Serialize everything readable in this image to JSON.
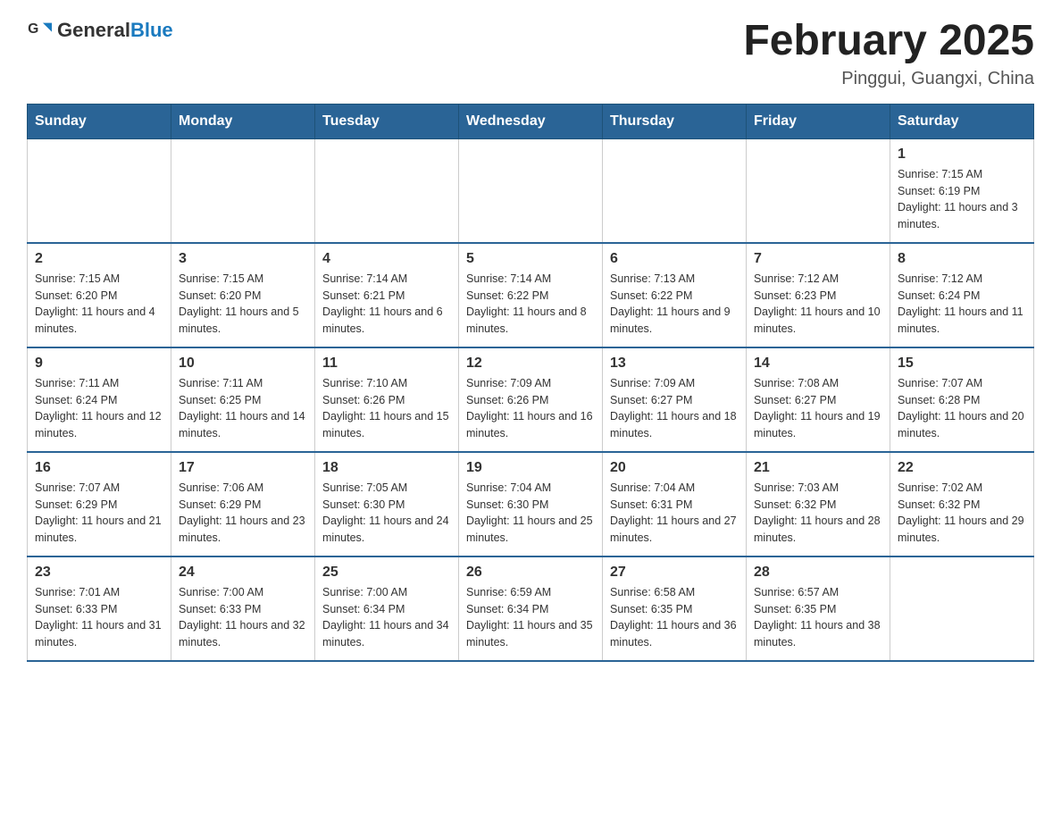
{
  "header": {
    "logo_general": "General",
    "logo_blue": "Blue",
    "month_title": "February 2025",
    "location": "Pinggui, Guangxi, China"
  },
  "days_of_week": [
    "Sunday",
    "Monday",
    "Tuesday",
    "Wednesday",
    "Thursday",
    "Friday",
    "Saturday"
  ],
  "weeks": [
    {
      "days": [
        {
          "num": "",
          "info": ""
        },
        {
          "num": "",
          "info": ""
        },
        {
          "num": "",
          "info": ""
        },
        {
          "num": "",
          "info": ""
        },
        {
          "num": "",
          "info": ""
        },
        {
          "num": "",
          "info": ""
        },
        {
          "num": "1",
          "info": "Sunrise: 7:15 AM\nSunset: 6:19 PM\nDaylight: 11 hours and 3 minutes."
        }
      ]
    },
    {
      "days": [
        {
          "num": "2",
          "info": "Sunrise: 7:15 AM\nSunset: 6:20 PM\nDaylight: 11 hours and 4 minutes."
        },
        {
          "num": "3",
          "info": "Sunrise: 7:15 AM\nSunset: 6:20 PM\nDaylight: 11 hours and 5 minutes."
        },
        {
          "num": "4",
          "info": "Sunrise: 7:14 AM\nSunset: 6:21 PM\nDaylight: 11 hours and 6 minutes."
        },
        {
          "num": "5",
          "info": "Sunrise: 7:14 AM\nSunset: 6:22 PM\nDaylight: 11 hours and 8 minutes."
        },
        {
          "num": "6",
          "info": "Sunrise: 7:13 AM\nSunset: 6:22 PM\nDaylight: 11 hours and 9 minutes."
        },
        {
          "num": "7",
          "info": "Sunrise: 7:12 AM\nSunset: 6:23 PM\nDaylight: 11 hours and 10 minutes."
        },
        {
          "num": "8",
          "info": "Sunrise: 7:12 AM\nSunset: 6:24 PM\nDaylight: 11 hours and 11 minutes."
        }
      ]
    },
    {
      "days": [
        {
          "num": "9",
          "info": "Sunrise: 7:11 AM\nSunset: 6:24 PM\nDaylight: 11 hours and 12 minutes."
        },
        {
          "num": "10",
          "info": "Sunrise: 7:11 AM\nSunset: 6:25 PM\nDaylight: 11 hours and 14 minutes."
        },
        {
          "num": "11",
          "info": "Sunrise: 7:10 AM\nSunset: 6:26 PM\nDaylight: 11 hours and 15 minutes."
        },
        {
          "num": "12",
          "info": "Sunrise: 7:09 AM\nSunset: 6:26 PM\nDaylight: 11 hours and 16 minutes."
        },
        {
          "num": "13",
          "info": "Sunrise: 7:09 AM\nSunset: 6:27 PM\nDaylight: 11 hours and 18 minutes."
        },
        {
          "num": "14",
          "info": "Sunrise: 7:08 AM\nSunset: 6:27 PM\nDaylight: 11 hours and 19 minutes."
        },
        {
          "num": "15",
          "info": "Sunrise: 7:07 AM\nSunset: 6:28 PM\nDaylight: 11 hours and 20 minutes."
        }
      ]
    },
    {
      "days": [
        {
          "num": "16",
          "info": "Sunrise: 7:07 AM\nSunset: 6:29 PM\nDaylight: 11 hours and 21 minutes."
        },
        {
          "num": "17",
          "info": "Sunrise: 7:06 AM\nSunset: 6:29 PM\nDaylight: 11 hours and 23 minutes."
        },
        {
          "num": "18",
          "info": "Sunrise: 7:05 AM\nSunset: 6:30 PM\nDaylight: 11 hours and 24 minutes."
        },
        {
          "num": "19",
          "info": "Sunrise: 7:04 AM\nSunset: 6:30 PM\nDaylight: 11 hours and 25 minutes."
        },
        {
          "num": "20",
          "info": "Sunrise: 7:04 AM\nSunset: 6:31 PM\nDaylight: 11 hours and 27 minutes."
        },
        {
          "num": "21",
          "info": "Sunrise: 7:03 AM\nSunset: 6:32 PM\nDaylight: 11 hours and 28 minutes."
        },
        {
          "num": "22",
          "info": "Sunrise: 7:02 AM\nSunset: 6:32 PM\nDaylight: 11 hours and 29 minutes."
        }
      ]
    },
    {
      "days": [
        {
          "num": "23",
          "info": "Sunrise: 7:01 AM\nSunset: 6:33 PM\nDaylight: 11 hours and 31 minutes."
        },
        {
          "num": "24",
          "info": "Sunrise: 7:00 AM\nSunset: 6:33 PM\nDaylight: 11 hours and 32 minutes."
        },
        {
          "num": "25",
          "info": "Sunrise: 7:00 AM\nSunset: 6:34 PM\nDaylight: 11 hours and 34 minutes."
        },
        {
          "num": "26",
          "info": "Sunrise: 6:59 AM\nSunset: 6:34 PM\nDaylight: 11 hours and 35 minutes."
        },
        {
          "num": "27",
          "info": "Sunrise: 6:58 AM\nSunset: 6:35 PM\nDaylight: 11 hours and 36 minutes."
        },
        {
          "num": "28",
          "info": "Sunrise: 6:57 AM\nSunset: 6:35 PM\nDaylight: 11 hours and 38 minutes."
        },
        {
          "num": "",
          "info": ""
        }
      ]
    }
  ]
}
